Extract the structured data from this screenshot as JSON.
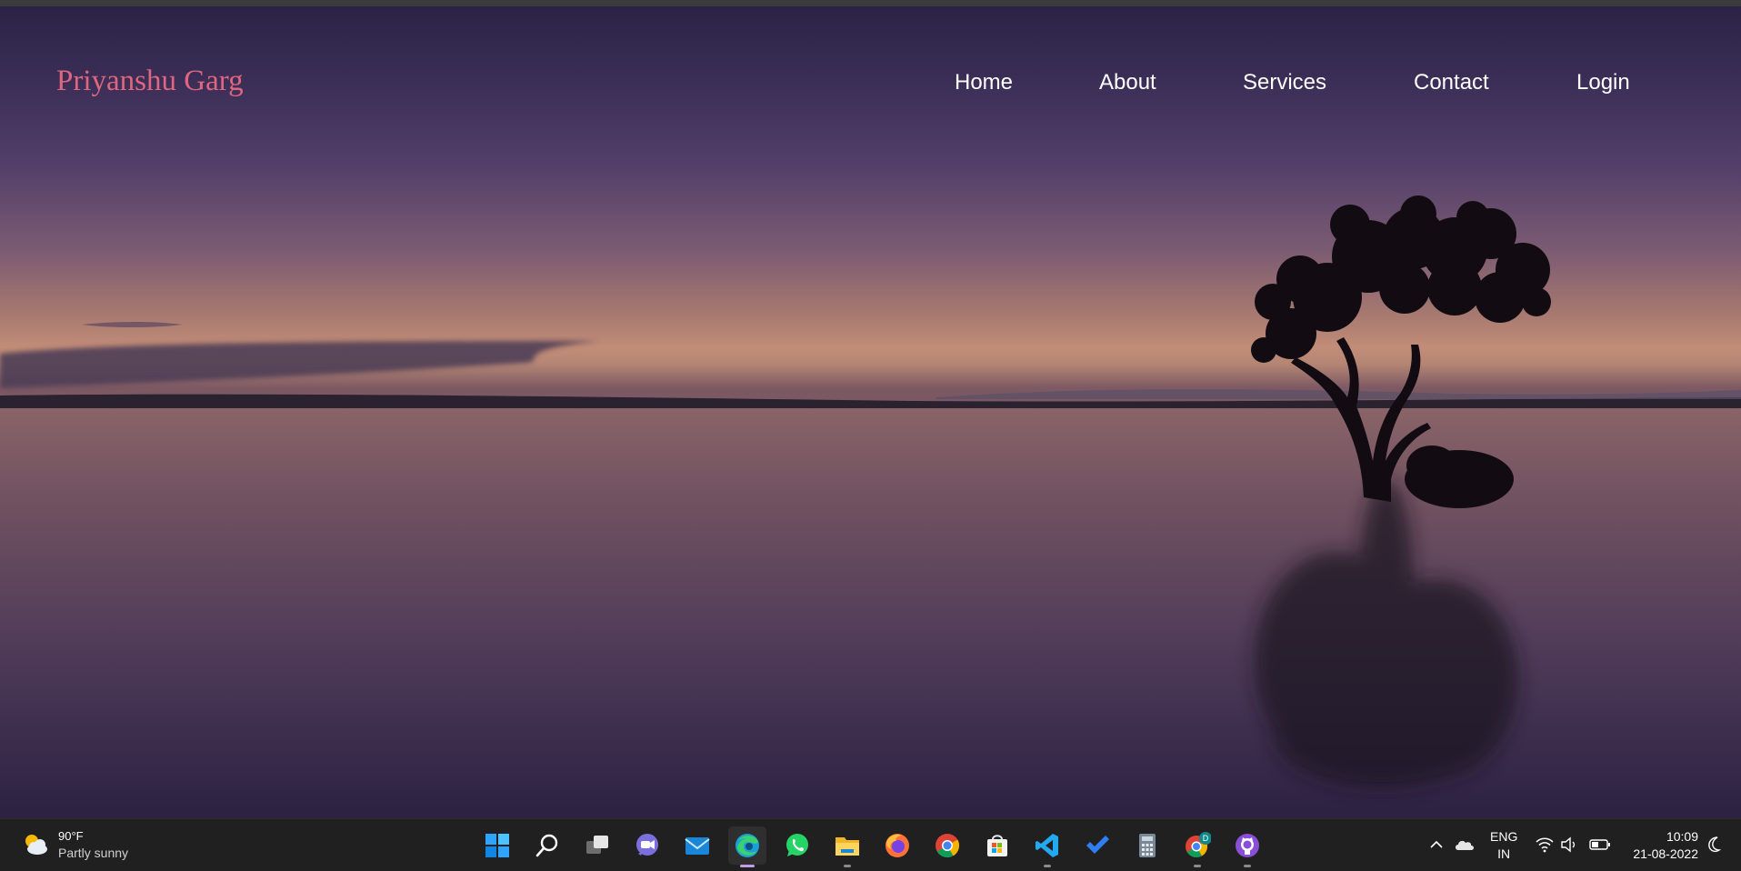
{
  "site": {
    "brand": "Priyanshu Garg",
    "nav": [
      {
        "id": "home",
        "label": "Home"
      },
      {
        "id": "about",
        "label": "About"
      },
      {
        "id": "services",
        "label": "Services"
      },
      {
        "id": "contact",
        "label": "Contact"
      },
      {
        "id": "login",
        "label": "Login"
      }
    ],
    "colors": {
      "brand": "#e0667f",
      "nav_text": "#ffffff"
    }
  },
  "taskbar": {
    "weather": {
      "temp": "90°F",
      "condition": "Partly sunny",
      "icon": "partly-sunny-icon"
    },
    "apps": [
      {
        "name": "start-icon"
      },
      {
        "name": "search-icon"
      },
      {
        "name": "task-view-icon"
      },
      {
        "name": "teams-chat-icon"
      },
      {
        "name": "mail-icon"
      },
      {
        "name": "edge-icon",
        "active": true
      },
      {
        "name": "whatsapp-icon"
      },
      {
        "name": "file-explorer-icon"
      },
      {
        "name": "firefox-icon"
      },
      {
        "name": "chrome-icon"
      },
      {
        "name": "store-icon"
      },
      {
        "name": "vscode-icon"
      },
      {
        "name": "todo-icon"
      },
      {
        "name": "calculator-icon"
      },
      {
        "name": "chrome-profile-icon",
        "badge": "D"
      },
      {
        "name": "github-desktop-icon"
      }
    ],
    "tray": {
      "language_line1": "ENG",
      "language_line2": "IN",
      "time": "10:09",
      "date": "21-08-2022"
    }
  }
}
